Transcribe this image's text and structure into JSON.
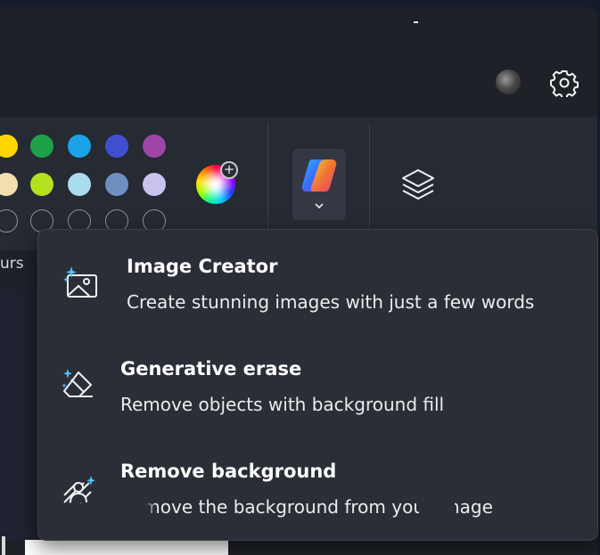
{
  "window": {
    "title_glyph": "-"
  },
  "header": {
    "avatar": "user-avatar",
    "settings_icon": "gear-icon"
  },
  "palette": {
    "row1": [
      "#ffd600",
      "#1fa14a",
      "#1aa3e6",
      "#3f4fcf",
      "#a144a8"
    ],
    "row2": [
      "#f1dfb0",
      "#b5e01e",
      "#a9dcef",
      "#6f8fc1",
      "#c9c3ef"
    ],
    "row3": [
      "empty",
      "empty",
      "empty",
      "empty",
      "empty"
    ],
    "label": "urs",
    "add_color_icon": "color-wheel-add-icon"
  },
  "toolbar": {
    "copilot_icon": "copilot-logo-icon",
    "copilot_dropdown_icon": "chevron-down-icon",
    "layers_icon": "layers-icon"
  },
  "menu": {
    "items": [
      {
        "icon": "image-creator-icon",
        "title": "Image Creator",
        "description": "Create stunning images with just a few words"
      },
      {
        "icon": "generative-erase-icon",
        "title": "Generative erase",
        "description": "Remove objects with background fill"
      },
      {
        "icon": "remove-background-icon",
        "title": "Remove background",
        "description": "Remove the background from your image"
      }
    ]
  }
}
